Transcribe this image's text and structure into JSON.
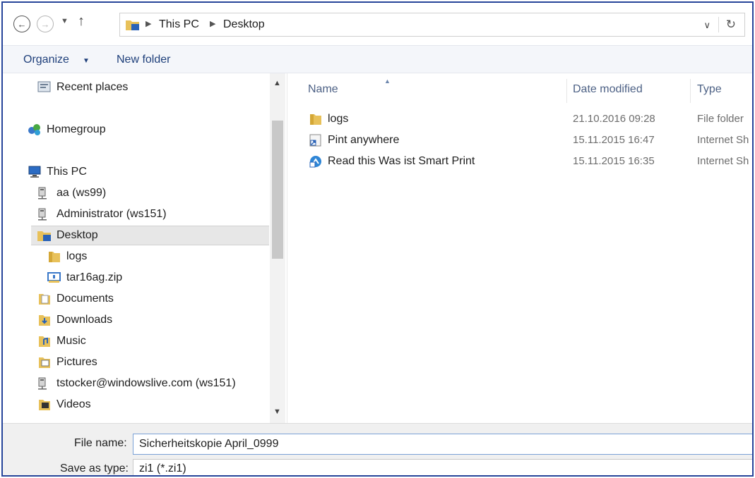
{
  "address": {
    "crumbs": [
      "This PC",
      "Desktop"
    ],
    "back_icon": "back-arrow-icon",
    "forward_icon": "forward-arrow-icon",
    "up_icon": "up-arrow-icon"
  },
  "toolbar": {
    "organize_label": "Organize",
    "new_folder_label": "New folder"
  },
  "nav": {
    "items": [
      {
        "label": "Recent places",
        "icon": "recent-places-icon"
      },
      {
        "label": "Homegroup",
        "icon": "homegroup-icon"
      },
      {
        "label": "This PC",
        "icon": "this-pc-icon"
      },
      {
        "label": "aa (ws99)",
        "icon": "network-drive-icon"
      },
      {
        "label": "Administrator (ws151)",
        "icon": "network-drive-icon"
      },
      {
        "label": "Desktop",
        "icon": "desktop-folder-icon",
        "selected": true
      },
      {
        "label": "logs",
        "icon": "folder-icon"
      },
      {
        "label": "tar16ag.zip",
        "icon": "zip-icon"
      },
      {
        "label": "Documents",
        "icon": "documents-icon"
      },
      {
        "label": "Downloads",
        "icon": "downloads-icon"
      },
      {
        "label": "Music",
        "icon": "music-icon"
      },
      {
        "label": "Pictures",
        "icon": "pictures-icon"
      },
      {
        "label": "tstocker@windowslive.com (ws151)",
        "icon": "network-drive-icon"
      },
      {
        "label": "Videos",
        "icon": "videos-icon"
      }
    ]
  },
  "files": {
    "columns": {
      "name": "Name",
      "date": "Date modified",
      "type": "Type"
    },
    "rows": [
      {
        "name": "logs",
        "date": "21.10.2016 09:28",
        "type": "File folder",
        "icon": "folder-icon"
      },
      {
        "name": "Pint anywhere",
        "date": "15.11.2015 16:47",
        "type": "Internet Sh",
        "icon": "shortcut-icon"
      },
      {
        "name": "Read this Was ist Smart Print",
        "date": "15.11.2015 16:35",
        "type": "Internet Sh",
        "icon": "smartprint-shortcut-icon"
      }
    ]
  },
  "bottom": {
    "file_name_label": "File name:",
    "file_name_value": "Sicherheitskopie April_0999",
    "save_type_label": "Save as type:",
    "save_type_value": "zi1  (*.zi1)"
  },
  "colors": {
    "frame_border": "#27459a",
    "toolbar_text": "#1e3f7a",
    "folder_yellow": "#e8c15a",
    "selection": "#e7e7e7"
  }
}
